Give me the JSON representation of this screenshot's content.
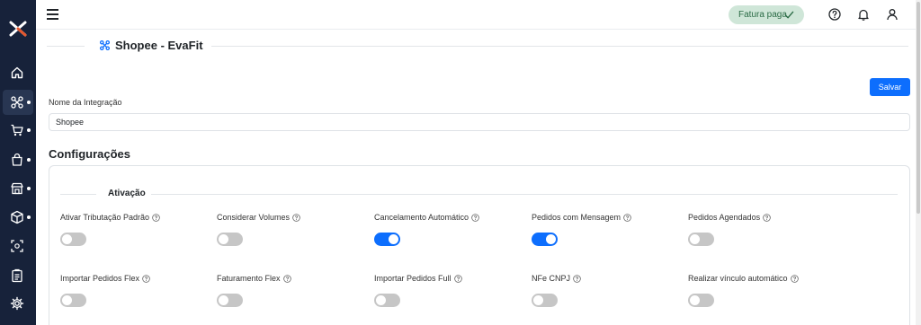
{
  "topbar": {
    "status_badge": "Fatura paga",
    "icons": [
      "menu-icon",
      "check-icon",
      "help-icon",
      "bell-icon",
      "user-icon"
    ]
  },
  "sidebar": {
    "items": [
      {
        "icon": "home-icon"
      },
      {
        "icon": "integrations-icon"
      },
      {
        "icon": "cart-icon"
      },
      {
        "icon": "shopping-bag-icon"
      },
      {
        "icon": "store-icon"
      },
      {
        "icon": "box-icon"
      },
      {
        "icon": "scan-icon"
      },
      {
        "icon": "clipboard-icon"
      },
      {
        "icon": "gear-icon"
      }
    ]
  },
  "page": {
    "title": "Shopee - EvaFit",
    "save_label": "Salvar"
  },
  "integration": {
    "name_label": "Nome da Integração",
    "name_value": "Shopee"
  },
  "config": {
    "title": "Configurações",
    "section_title": "Ativação",
    "options": [
      {
        "label": "Ativar Tributação Padrão",
        "enabled": false
      },
      {
        "label": "Considerar Volumes",
        "enabled": false
      },
      {
        "label": "Cancelamento Automático",
        "enabled": true
      },
      {
        "label": "Pedidos com Mensagem",
        "enabled": true
      },
      {
        "label": "Pedidos Agendados",
        "enabled": false
      },
      {
        "label": "Importar Pedidos Flex",
        "enabled": false
      },
      {
        "label": "Faturamento Flex",
        "enabled": false
      },
      {
        "label": "Importar Pedidos Full",
        "enabled": false
      },
      {
        "label": "NFe CNPJ",
        "enabled": false
      },
      {
        "label": "Realizar vínculo automático",
        "enabled": false
      }
    ]
  },
  "colors": {
    "sidebar_bg": "#17223a",
    "primary": "#0d6efd",
    "badge_bg": "#cfe6d8",
    "badge_text": "#2a6b45"
  }
}
